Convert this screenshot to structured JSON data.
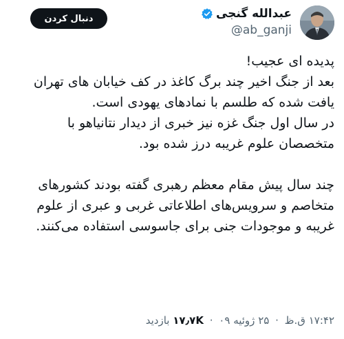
{
  "author": {
    "display_name": "عبدالله گنجی",
    "handle": "@ab_ganji",
    "verified": true,
    "avatar_icon": "profile-photo"
  },
  "follow_button": {
    "label": "دنبال کردن"
  },
  "tweet": {
    "lines": [
      "پدیده ای عجیب!",
      "بعد از جنگ اخیر چند برگ کاغذ در کف خیابان های تهران",
      "یافت شده که طلسم با نمادهای یهودی است.",
      "در سال اول جنگ غزه نیز خبری از دیدار نتانیاهو با",
      "متخصصان علوم غریبه درز شده بود.",
      "چند سال پیش مقام معظم رهبری گفته بودند کشورهای",
      "متخاصم و سرویس‌های اطلاعاتی غربی و عبری از علوم",
      "غریبه و موجودات جنی برای جاسوسی استفاده می‌کنند."
    ]
  },
  "meta": {
    "time": "۱۷:۴۲ ق.ظ",
    "date": "۲۵ ژوئیه ۰۹",
    "views_count": "۱۷٫۷K",
    "views_label": "بازدید"
  },
  "colors": {
    "text": "#0f1419",
    "secondary": "#536471",
    "verified": "#1d9bf0",
    "button_bg": "#0f1419"
  }
}
